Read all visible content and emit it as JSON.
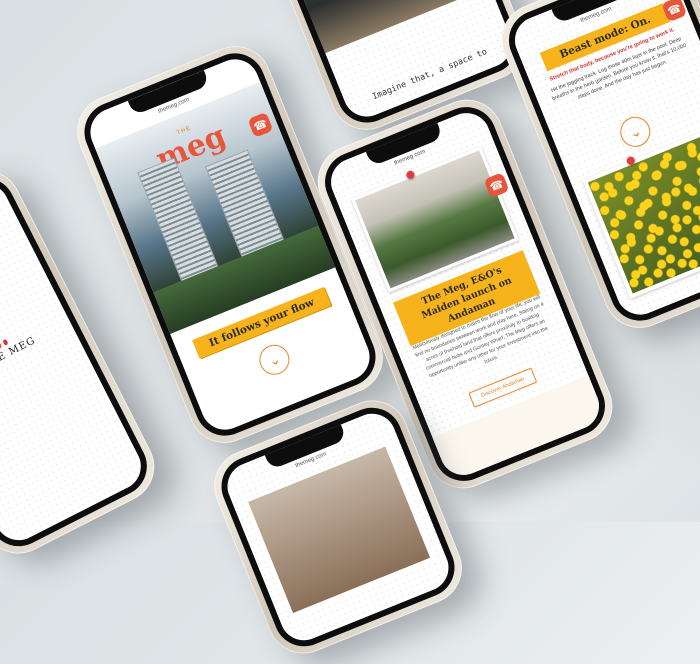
{
  "phone_left": {
    "logo_text": "THE MEG",
    "logo_dot_colors": [
      "#222222",
      "#f7b31c",
      "#e8553a",
      "#d2332f"
    ]
  },
  "phone_hero": {
    "time": "",
    "url": "themeg.com",
    "logo_small": "THE",
    "logo": "meg",
    "ribbon": "It follows your flow",
    "badge_icon": "chat-icon",
    "scroll_icon": "chevron-down-icon"
  },
  "phone_top": {
    "tagline": "Imagine that, a space to"
  },
  "phone_center": {
    "url": "themeg.com",
    "title": "The Meg, E&O's Maiden launch on Andaman",
    "paragraph": "Meticulously designed to match the flow of your life, you will find no boundaries between work and play here. Sitting on 4 acres of freehold land that offers proximity to bustling commercial hubs and Gurney Wharf, The Meg offers an opportunity unlike any other for your investment into the future.",
    "button": "Discover Andaman"
  },
  "phone_right": {
    "url": "themeg.com",
    "heading": "Beast mode: On.",
    "lead": "Stretch that body, because you're going to work it.",
    "paragraph": "Hit the jogging track. Log those 40m laps in the pool. Deep breaths in the herb garden. Before you know it, that's 10,000 steps done. And the day has just begun."
  },
  "phone_bottom": {
    "url": "themeg.com"
  },
  "colors": {
    "accent_orange": "#e8842a",
    "ribbon_yellow": "#f7b31c",
    "brand_red": "#e8553a"
  }
}
